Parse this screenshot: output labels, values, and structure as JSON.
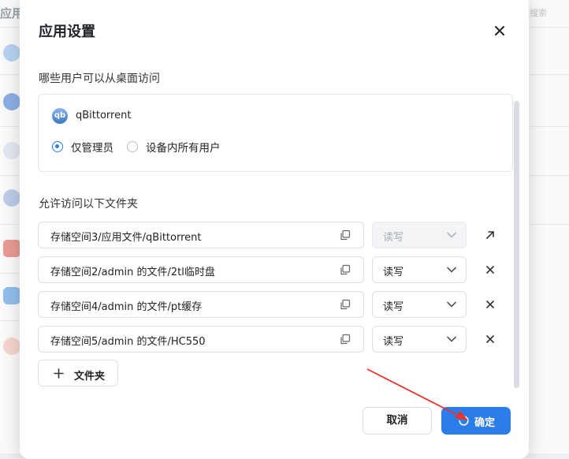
{
  "background": {
    "title": "应用",
    "search_placeholder": "搜索"
  },
  "dialog": {
    "title": "应用设置",
    "access_section_label": "哪些用户可以从桌面访问",
    "app": {
      "name": "qBittorrent",
      "icon": "qb",
      "icon_name": "qbittorrent-app-icon"
    },
    "access_options": [
      {
        "label": "仅管理员",
        "checked": true
      },
      {
        "label": "设备内所有用户",
        "checked": false
      }
    ],
    "folders_section_label": "允许访问以下文件夹",
    "folders": [
      {
        "path": "存储空间3/应用文件/qBittorrent",
        "permission": "读写",
        "disabled": true,
        "action_icon": "open-external-icon"
      },
      {
        "path": "存储空间2/admin 的文件/2tl临时盘",
        "permission": "读写",
        "disabled": false,
        "action_icon": "remove-icon"
      },
      {
        "path": "存储空间4/admin 的文件/pt缓存",
        "permission": "读写",
        "disabled": false,
        "action_icon": "remove-icon"
      },
      {
        "path": "存储空间5/admin 的文件/HC550",
        "permission": "读写",
        "disabled": false,
        "action_icon": "remove-icon"
      }
    ],
    "add_folder_label": "文件夹",
    "cancel_label": "取消",
    "confirm_label": "确定",
    "accent_color": "#2b7de9",
    "annotation_arrow_color": "#e8322c"
  }
}
